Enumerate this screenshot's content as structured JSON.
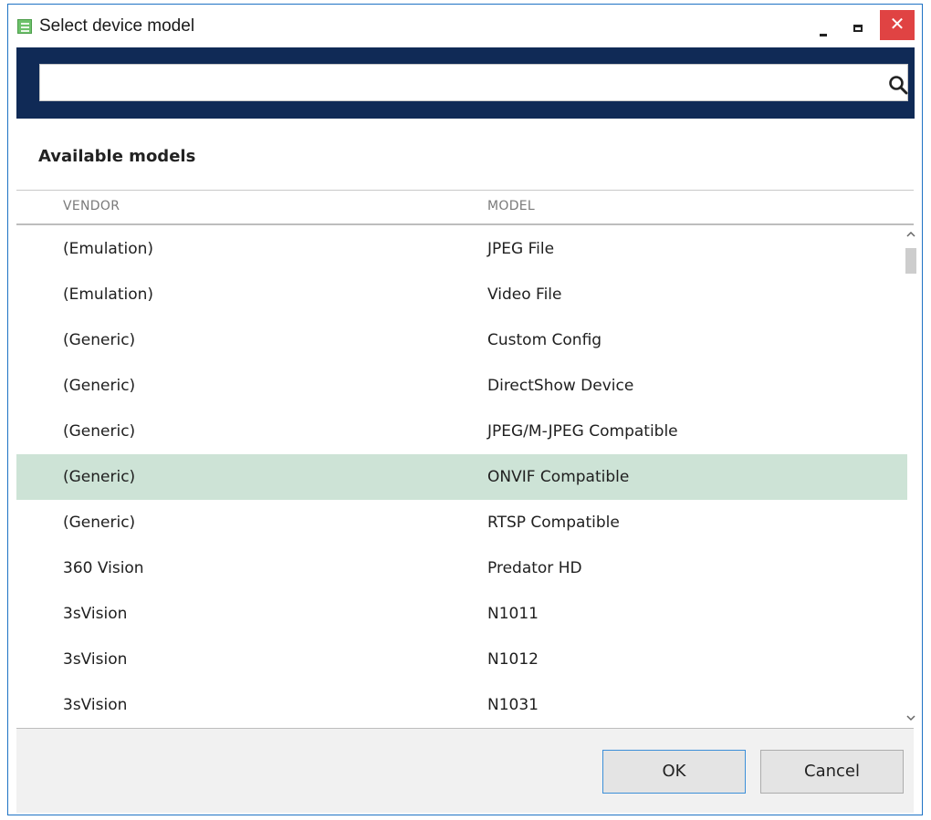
{
  "window": {
    "title": "Select device model",
    "close_glyph": "✕"
  },
  "search": {
    "value": "",
    "placeholder": ""
  },
  "section": {
    "title": "Available models"
  },
  "table": {
    "columns": [
      "VENDOR",
      "MODEL"
    ],
    "selected_index": 5,
    "rows": [
      {
        "vendor": "(Emulation)",
        "model": "JPEG File"
      },
      {
        "vendor": "(Emulation)",
        "model": "Video File"
      },
      {
        "vendor": "(Generic)",
        "model": "Custom Config"
      },
      {
        "vendor": "(Generic)",
        "model": "DirectShow Device"
      },
      {
        "vendor": "(Generic)",
        "model": "JPEG/M-JPEG Compatible"
      },
      {
        "vendor": "(Generic)",
        "model": "ONVIF Compatible"
      },
      {
        "vendor": "(Generic)",
        "model": "RTSP Compatible"
      },
      {
        "vendor": "360 Vision",
        "model": "Predator HD"
      },
      {
        "vendor": "3sVision",
        "model": "N1011"
      },
      {
        "vendor": "3sVision",
        "model": "N1012"
      },
      {
        "vendor": "3sVision",
        "model": "N1031"
      }
    ]
  },
  "footer": {
    "ok_label": "OK",
    "cancel_label": "Cancel"
  },
  "colors": {
    "accent_band": "#102a56",
    "selected_row": "#cde3d6",
    "close_button": "#e04343"
  },
  "icons": [
    "app-icon",
    "minimize-icon",
    "maximize-icon",
    "close-icon",
    "search-icon",
    "scroll-up-icon",
    "scroll-down-icon"
  ]
}
